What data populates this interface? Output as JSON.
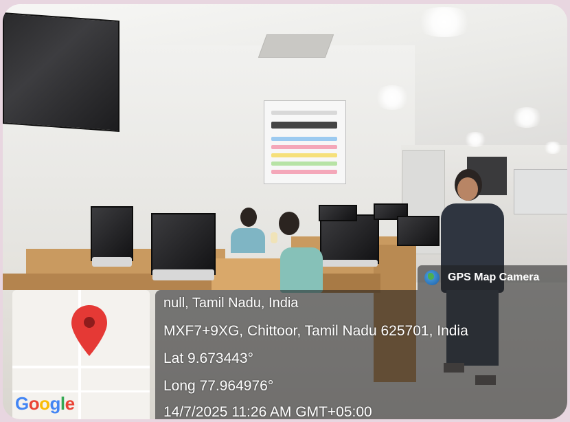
{
  "overlay": {
    "badge": "GPS Map Camera",
    "address_line1": "null, Tamil Nadu, India",
    "address_line2": "MXF7+9XG, Chittoor, Tamil Nadu 625701, India",
    "lat": "Lat 9.673443°",
    "long": "Long 77.964976°",
    "timestamp": "14/7/2025 11:26 AM GMT+05:00",
    "map_brand": [
      "G",
      "o",
      "o",
      "g",
      "l",
      "e"
    ]
  },
  "colors": {
    "pin": "#e53935",
    "google": [
      "#4285F4",
      "#EA4335",
      "#FBBC05",
      "#4285F4",
      "#34A853",
      "#EA4335"
    ]
  },
  "icons": {
    "badge_icon": "globe-icon",
    "map_marker": "location-pin-icon"
  }
}
